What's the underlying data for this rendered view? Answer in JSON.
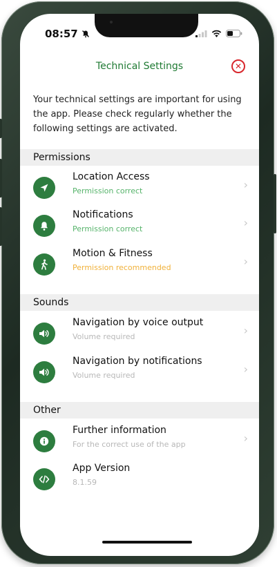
{
  "status_bar": {
    "time": "08:57"
  },
  "header": {
    "title": "Technical Settings"
  },
  "intro_text": "Your technical settings are important for using the app. Please check regularly whether the following settings are activated.",
  "sections": {
    "permissions": {
      "label": "Permissions",
      "items": [
        {
          "title": "Location Access",
          "subtitle": "Permission correct",
          "icon": "location-arrow-icon"
        },
        {
          "title": "Notifications",
          "subtitle": "Permission correct",
          "icon": "bell-icon"
        },
        {
          "title": "Motion & Fitness",
          "subtitle": "Permission recommended",
          "icon": "walking-person-icon"
        }
      ]
    },
    "sounds": {
      "label": "Sounds",
      "items": [
        {
          "title": "Navigation by voice output",
          "subtitle": "Volume required",
          "icon": "speaker-icon"
        },
        {
          "title": "Navigation by notifications",
          "subtitle": "Volume required",
          "icon": "speaker-icon"
        }
      ]
    },
    "other": {
      "label": "Other",
      "items": [
        {
          "title": "Further information",
          "subtitle": "For the correct use of the app",
          "icon": "info-icon"
        },
        {
          "title": "App Version",
          "subtitle": "8.1.59",
          "icon": "code-icon"
        }
      ]
    }
  },
  "colors": {
    "brand_green": "#2d7d3f",
    "header_green": "#1f7a33",
    "status_ok": "#55b36a",
    "status_warning": "#f0b13a",
    "close_red": "#d8262c"
  }
}
